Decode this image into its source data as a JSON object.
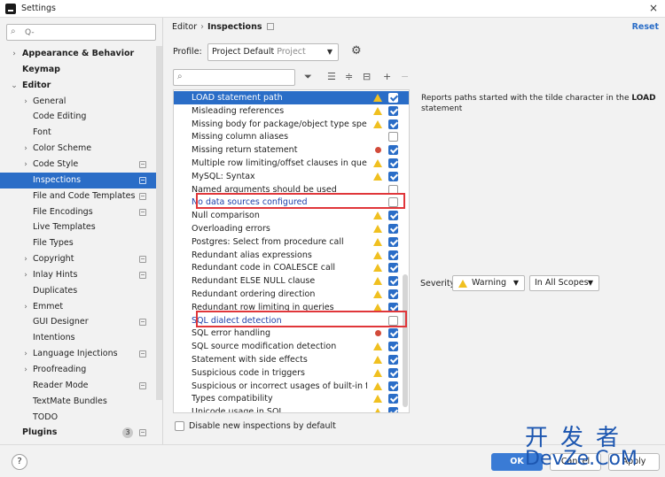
{
  "window": {
    "title": "Settings",
    "close": "×"
  },
  "sidebar": {
    "search_placeholder": "Q-",
    "items": [
      {
        "label": "Appearance & Behavior",
        "chev": "›",
        "bold": true,
        "indent": 0
      },
      {
        "label": "Keymap",
        "chev": "",
        "bold": true,
        "indent": 0
      },
      {
        "label": "Editor",
        "chev": "⌄",
        "bold": true,
        "indent": 0
      },
      {
        "label": "General",
        "chev": "›",
        "indent": 1
      },
      {
        "label": "Code Editing",
        "chev": "",
        "indent": 1
      },
      {
        "label": "Font",
        "chev": "",
        "indent": 1
      },
      {
        "label": "Color Scheme",
        "chev": "›",
        "indent": 1
      },
      {
        "label": "Code Style",
        "chev": "›",
        "indent": 1,
        "proj": true
      },
      {
        "label": "Inspections",
        "chev": "",
        "indent": 1,
        "selected": true,
        "proj": true
      },
      {
        "label": "File and Code Templates",
        "chev": "",
        "indent": 1,
        "proj": true
      },
      {
        "label": "File Encodings",
        "chev": "",
        "indent": 1,
        "proj": true
      },
      {
        "label": "Live Templates",
        "chev": "",
        "indent": 1
      },
      {
        "label": "File Types",
        "chev": "",
        "indent": 1
      },
      {
        "label": "Copyright",
        "chev": "›",
        "indent": 1,
        "proj": true
      },
      {
        "label": "Inlay Hints",
        "chev": "›",
        "indent": 1,
        "proj": true
      },
      {
        "label": "Duplicates",
        "chev": "",
        "indent": 1
      },
      {
        "label": "Emmet",
        "chev": "›",
        "indent": 1
      },
      {
        "label": "GUI Designer",
        "chev": "",
        "indent": 1,
        "proj": true
      },
      {
        "label": "Intentions",
        "chev": "",
        "indent": 1
      },
      {
        "label": "Language Injections",
        "chev": "›",
        "indent": 1,
        "proj": true
      },
      {
        "label": "Proofreading",
        "chev": "›",
        "indent": 1
      },
      {
        "label": "Reader Mode",
        "chev": "",
        "indent": 1,
        "proj": true
      },
      {
        "label": "TextMate Bundles",
        "chev": "",
        "indent": 1
      },
      {
        "label": "TODO",
        "chev": "",
        "indent": 1
      },
      {
        "label": "Plugins",
        "chev": "",
        "bold": true,
        "indent": 0,
        "badge": "3",
        "proj": true
      }
    ]
  },
  "header": {
    "crumb_parent": "Editor",
    "crumb_sep": "›",
    "crumb_current": "Inspections",
    "reset": "Reset"
  },
  "profile": {
    "label": "Profile:",
    "value": "Project Default",
    "sub": "Project"
  },
  "inspections": {
    "search_placeholder": "Q-",
    "rows": [
      {
        "name": "LOAD statement path",
        "icon": "warn",
        "checked": true,
        "selected": true
      },
      {
        "name": "Misleading references",
        "icon": "warn",
        "checked": true
      },
      {
        "name": "Missing body for package/object type specification",
        "icon": "warn",
        "checked": true
      },
      {
        "name": "Missing column aliases",
        "icon": "",
        "checked": false
      },
      {
        "name": "Missing return statement",
        "icon": "err",
        "checked": true
      },
      {
        "name": "Multiple row limiting/offset clauses in queries",
        "icon": "warn",
        "checked": true
      },
      {
        "name": "MySQL: Syntax",
        "icon": "warn",
        "checked": true
      },
      {
        "name": "Named arguments should be used",
        "icon": "",
        "checked": false
      },
      {
        "name": "No data sources configured",
        "icon": "",
        "checked": false,
        "link": true
      },
      {
        "name": "Null comparison",
        "icon": "warn",
        "checked": true
      },
      {
        "name": "Overloading errors",
        "icon": "warn",
        "checked": true
      },
      {
        "name": "Postgres: Select from procedure call",
        "icon": "warn",
        "checked": true
      },
      {
        "name": "Redundant alias expressions",
        "icon": "warn",
        "checked": true
      },
      {
        "name": "Redundant code in COALESCE call",
        "icon": "warn",
        "checked": true
      },
      {
        "name": "Redundant ELSE NULL clause",
        "icon": "warn",
        "checked": true
      },
      {
        "name": "Redundant ordering direction",
        "icon": "warn",
        "checked": true
      },
      {
        "name": "Redundant row limiting in queries",
        "icon": "warn",
        "checked": true
      },
      {
        "name": "SQL dialect detection",
        "icon": "",
        "checked": false,
        "link": true
      },
      {
        "name": "SQL error handling",
        "icon": "err",
        "checked": true
      },
      {
        "name": "SQL source modification detection",
        "icon": "warn",
        "checked": true
      },
      {
        "name": "Statement with side effects",
        "icon": "warn",
        "checked": true
      },
      {
        "name": "Suspicious code in triggers",
        "icon": "warn",
        "checked": true
      },
      {
        "name": "Suspicious or incorrect usages of built-in functions",
        "icon": "warn",
        "checked": true
      },
      {
        "name": "Types compatibility",
        "icon": "warn",
        "checked": true
      },
      {
        "name": "Unicode usage in SQL",
        "icon": "warn",
        "checked": true
      }
    ]
  },
  "description": {
    "text_before": "Reports paths started with the tilde character in the ",
    "bold": "LOAD",
    "text_after": " statement"
  },
  "severity": {
    "label": "Severity:",
    "value": "Warning",
    "scope": "In All Scopes"
  },
  "disable_new": "Disable new inspections by default",
  "buttons": {
    "help": "?",
    "ok": "OK",
    "cancel": "Cancel",
    "apply": "Apply"
  },
  "watermark": {
    "cn": "开发者",
    "en": "DevZe.CoM"
  },
  "colors": {
    "accent": "#2a6dc7",
    "highlight": "#e0363a",
    "warn": "#f0c020",
    "error": "#d24b3a"
  }
}
